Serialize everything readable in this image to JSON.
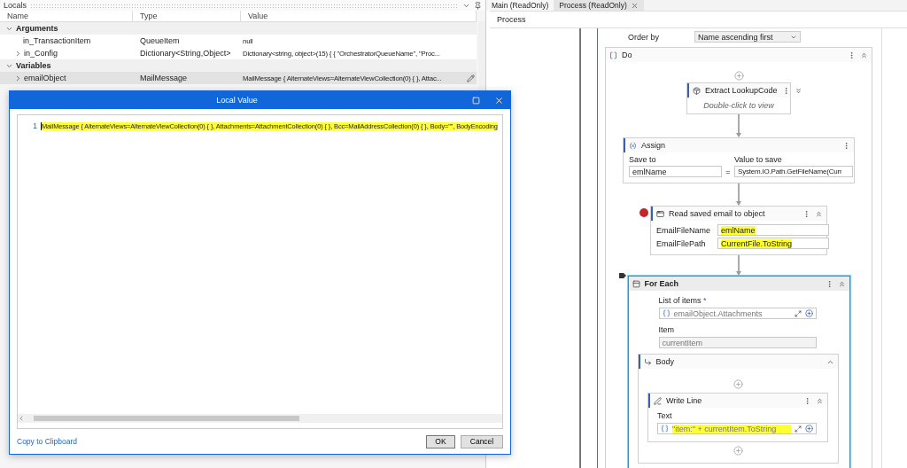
{
  "locals": {
    "title": "Locals",
    "columns": [
      "Name",
      "Type",
      "Value"
    ],
    "groups": [
      {
        "label": "Arguments",
        "expanded": true,
        "rows": [
          {
            "name": "in_TransactionItem",
            "type": "QueueItem",
            "value": "null",
            "expandable": false,
            "selected": false
          },
          {
            "name": "in_Config",
            "type": "Dictionary<String,Object>",
            "value": "Dictionary<string, object>(15) { { \"OrchestratorQueueName\", \"Proc...",
            "expandable": true,
            "selected": false
          }
        ]
      },
      {
        "label": "Variables",
        "expanded": true,
        "rows": [
          {
            "name": "emailObject",
            "type": "MailMessage",
            "value": "MailMessage { AlternateViews=AlternateViewCollection(0) { }, Attac...",
            "expandable": true,
            "selected": true
          }
        ]
      }
    ]
  },
  "dialog": {
    "title": "Local Value",
    "lines": [
      {
        "number": "1",
        "text": "MailMessage { AlternateViews=AlternateViewCollection(0) { }, Attachments=AttachmentCollection(0) { }, Bcc=MailAddressCollection(0) { }, Body=\"\", BodyEncoding",
        "highlighted": true
      }
    ],
    "link": "Copy to Clipboard",
    "buttons": [
      {
        "label": "OK",
        "primary": true
      },
      {
        "label": "Cancel",
        "primary": false
      }
    ]
  },
  "designer": {
    "tabs": [
      {
        "label": "Main (ReadOnly)",
        "selected": false,
        "closable": false
      },
      {
        "label": "Process (ReadOnly)",
        "selected": true,
        "closable": true
      }
    ],
    "breadcrumb": "Process",
    "order_by": {
      "label": "Order by",
      "value": "Name ascending first"
    },
    "do": {
      "title": "Do",
      "extract": {
        "title": "Extract LookupCode",
        "hint": "Double-click to view"
      },
      "assign": {
        "title": "Assign",
        "to_label": "Save to",
        "to": "emlName",
        "operator": "=",
        "value_label": "Value to save",
        "value": "System.IO.Path.GetFileName(Curr"
      },
      "read_email": {
        "title": "Read saved email to object",
        "breakpoint": true,
        "fields": [
          {
            "label": "EmailFileName",
            "value": "emlName",
            "highlighted": true
          },
          {
            "label": "EmailFilePath",
            "value": "CurrentFile.ToString",
            "highlighted": true
          }
        ]
      },
      "for_each": {
        "title": "For Each",
        "selected": true,
        "current": true,
        "list_label": "List of items",
        "required_mark": "*",
        "list_value": "emailObject.Attachments",
        "list_highlighted": false,
        "item_label": "Item",
        "item_value": "currentItem",
        "body": {
          "title": "Body",
          "write_line": {
            "title": "Write Line",
            "text_label": "Text",
            "text_value": "\"item:\" + currentItem.ToString",
            "highlighted": true
          }
        }
      }
    }
  }
}
